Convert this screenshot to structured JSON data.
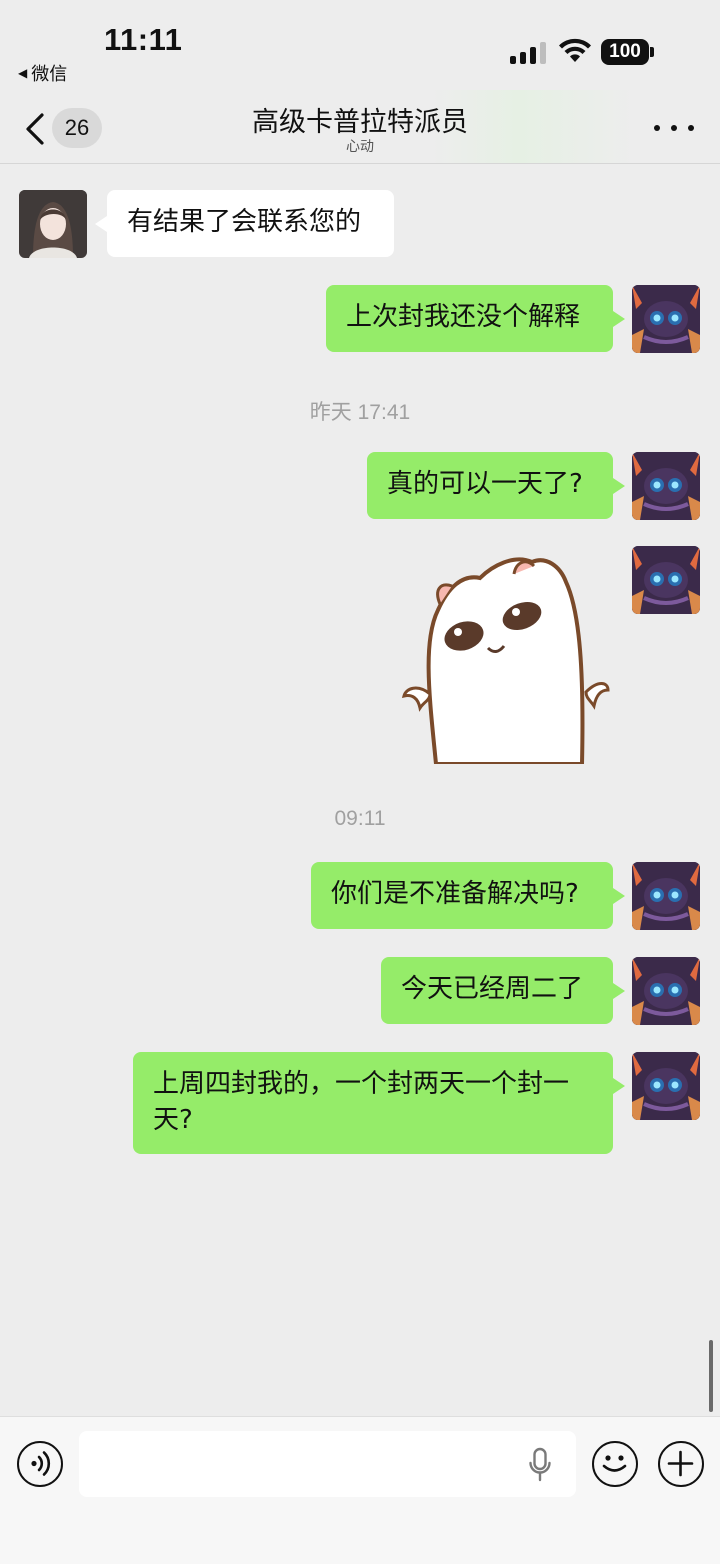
{
  "status_bar": {
    "time": "11:11",
    "back_app": "微信",
    "back_app_arrow": "◀",
    "battery": "100"
  },
  "nav": {
    "back_icon": "chevron-left-icon",
    "unread_count": "26",
    "title": "高级卡普拉特派员",
    "subtitle": "心动",
    "more_icon": "ellipsis-icon"
  },
  "colors": {
    "background": "#ededed",
    "outgoing_bubble": "#95ec69",
    "incoming_bubble": "#ffffff",
    "timestamp": "#a0a0a0"
  },
  "messages": [
    {
      "direction": "in",
      "text": "有结果了会联系您的"
    },
    {
      "direction": "out",
      "text": "上次封我还没个解释"
    },
    {
      "type": "timestamp",
      "text": "昨天 17:41"
    },
    {
      "direction": "out",
      "text": "真的可以一天了?"
    },
    {
      "direction": "out",
      "type": "sticker",
      "icon": "shrugging-cat-sticker"
    },
    {
      "type": "timestamp",
      "text": "09:11"
    },
    {
      "direction": "out",
      "text": "你们是不准备解决吗?"
    },
    {
      "direction": "out",
      "text": "今天已经周二了"
    },
    {
      "direction": "out",
      "text": "上周四封我的，一个封两天一个封一天?"
    }
  ],
  "input_bar": {
    "voice_icon": "voice-mode-icon",
    "mic_icon": "microphone-icon",
    "emoji_icon": "emoji-icon",
    "plus_icon": "plus-icon",
    "value": ""
  }
}
